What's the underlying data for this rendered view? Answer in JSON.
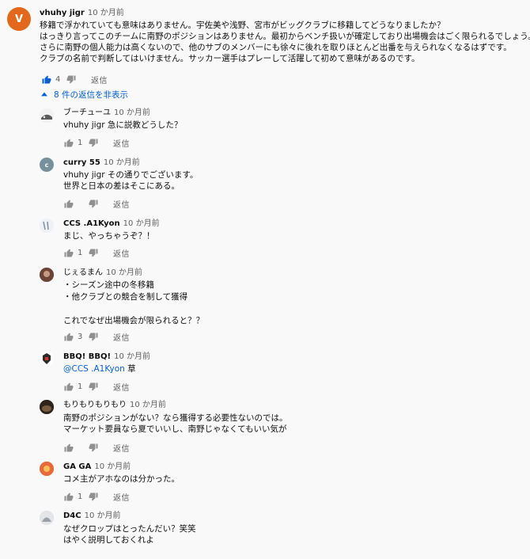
{
  "top_comment": {
    "avatar_letter": "V",
    "author": "vhuhy jigr",
    "time": "10 か月前",
    "lines": [
      "移籍で浮かれていても意味はありません。宇佐美や浅野、宮市がビッグクラブに移籍してどうなりましたか？",
      "はっきり言ってこのチームに南野のポジションはありません。最初からベンチ扱いが確定しており出場機会はごく限られるでしょう。",
      "さらに南野の個人能力は高くないので、他のサブのメンバーにも徐々に後れを取りほとんど出番を与えられなくなるはずです。",
      "クラブの名前で判断してはいけません。サッカー選手はプレーして活躍して初めて意味があるのです。"
    ],
    "likes": "4",
    "reply_label": "返信"
  },
  "replies_toggle": "8 件の返信を非表示",
  "replies": [
    {
      "author": "ブーチューユ",
      "time": "10 か月前",
      "mention": "",
      "lines": [
        "vhuhy jigr 急に説教どうした？"
      ],
      "likes": "1",
      "reply_label": "返信",
      "avatar_color": "#6b6b6b",
      "avatar_letter": ""
    },
    {
      "author": "curry 55",
      "time": "10 か月前",
      "mention": "",
      "lines": [
        "vhuhy jigr その通りでございます。",
        "世界と日本の差はそこにある。"
      ],
      "likes": "",
      "reply_label": "返信",
      "avatar_color": "#78909c",
      "avatar_letter": "c"
    },
    {
      "author": "CCS .A1Kyon",
      "time": "10 か月前",
      "mention": "",
      "lines": [
        "まじ、やっちゃうぞ？！"
      ],
      "likes": "1",
      "reply_label": "返信",
      "avatar_color": "#d8dde6",
      "avatar_letter": ""
    },
    {
      "author": "じぇるまん",
      "time": "10 か月前",
      "mention": "",
      "lines": [
        "・シーズン途中の冬移籍",
        "・他クラブとの競合を制して獲得",
        "",
        "これでなぜ出場機会が限られると？？"
      ],
      "likes": "3",
      "reply_label": "返信",
      "avatar_color": "#8a5a4a",
      "avatar_letter": ""
    },
    {
      "author": "BBQ! BBQ!",
      "time": "10 か月前",
      "mention": "@CCS .A1Kyon",
      "lines": [
        " 草"
      ],
      "likes": "1",
      "reply_label": "返信",
      "avatar_color": "#ffffff",
      "avatar_letter": ""
    },
    {
      "author": "もりもりもりもり",
      "time": "10 か月前",
      "mention": "",
      "lines": [
        "南野のポジションがない？なら獲得する必要性ないのでは。",
        "マーケット要員なら夏でいいし、南野じゃなくてもいい気が"
      ],
      "likes": "",
      "reply_label": "返信",
      "avatar_color": "#3e2f24",
      "avatar_letter": ""
    },
    {
      "author": "GA GA",
      "time": "10 か月前",
      "mention": "",
      "lines": [
        "コメ主がアホなのは分かった。"
      ],
      "likes": "1",
      "reply_label": "返信",
      "avatar_color": "#e86a3a",
      "avatar_letter": ""
    },
    {
      "author": "D4C",
      "time": "10 か月前",
      "mention": "",
      "lines": [
        "なぜクロップはとったんだい？笑笑",
        "はやく説明しておくれよ"
      ],
      "likes": "",
      "reply_label": "返信",
      "avatar_color": "#cfd2d6",
      "avatar_letter": ""
    }
  ]
}
